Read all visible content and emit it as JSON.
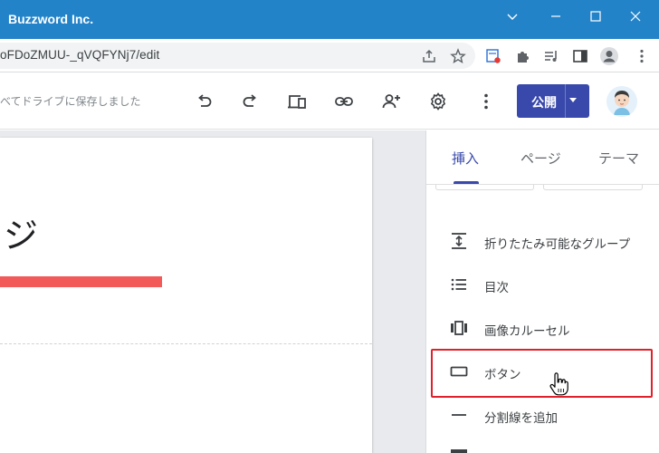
{
  "window": {
    "title": "Buzzword Inc.",
    "titlebar_color": "#2383c9"
  },
  "addressbar": {
    "url": "oFDoZMUU-_qVQFYNj7/edit"
  },
  "toolbar": {
    "save_status": "べてドライブに保存しました",
    "publish_label": "公開",
    "accent_color": "#3949ab"
  },
  "canvas": {
    "title_fragment": "ジ",
    "accent_bar_color": "#f25959"
  },
  "panel": {
    "tabs": [
      {
        "label": "挿入",
        "active": true
      },
      {
        "label": "ページ",
        "active": false
      },
      {
        "label": "テーマ",
        "active": false
      }
    ],
    "items": [
      {
        "label": "折りたたみ可能なグループ",
        "icon": "collapsible-group-icon"
      },
      {
        "label": "目次",
        "icon": "table-of-contents-icon"
      },
      {
        "label": "画像カルーセル",
        "icon": "image-carousel-icon"
      },
      {
        "label": "ボタン",
        "icon": "button-icon",
        "highlighted": true
      },
      {
        "label": "分割線を追加",
        "icon": "divider-icon"
      }
    ],
    "highlight_color": "#e0202a"
  }
}
